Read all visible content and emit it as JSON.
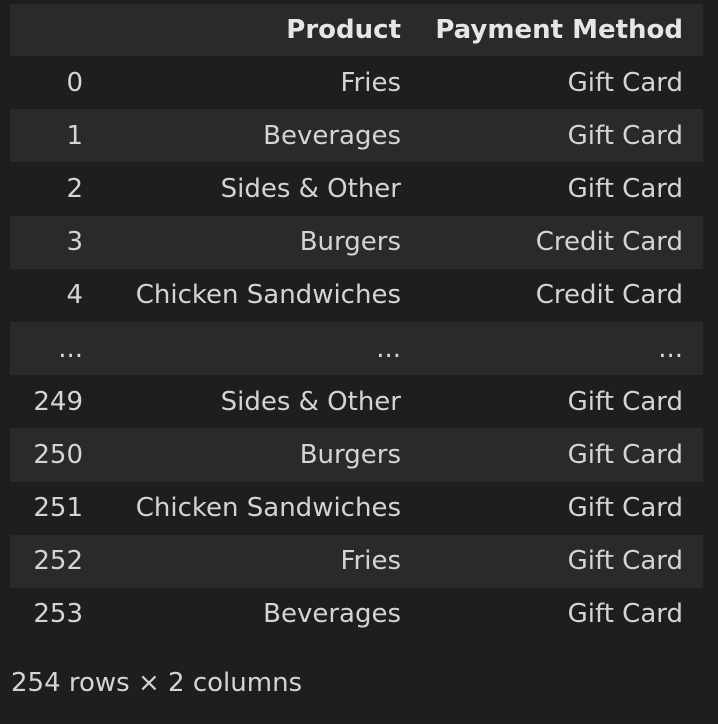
{
  "table": {
    "headers": {
      "index": "",
      "product": "Product",
      "payment": "Payment Method"
    },
    "rows": [
      {
        "index": "0",
        "product": "Fries",
        "payment": "Gift Card"
      },
      {
        "index": "1",
        "product": "Beverages",
        "payment": "Gift Card"
      },
      {
        "index": "2",
        "product": "Sides & Other",
        "payment": "Gift Card"
      },
      {
        "index": "3",
        "product": "Burgers",
        "payment": "Credit Card"
      },
      {
        "index": "4",
        "product": "Chicken Sandwiches",
        "payment": "Credit Card"
      },
      {
        "index": "...",
        "product": "...",
        "payment": "..."
      },
      {
        "index": "249",
        "product": "Sides & Other",
        "payment": "Gift Card"
      },
      {
        "index": "250",
        "product": "Burgers",
        "payment": "Gift Card"
      },
      {
        "index": "251",
        "product": "Chicken Sandwiches",
        "payment": "Gift Card"
      },
      {
        "index": "252",
        "product": "Fries",
        "payment": "Gift Card"
      },
      {
        "index": "253",
        "product": "Beverages",
        "payment": "Gift Card"
      }
    ]
  },
  "summary": "254 rows × 2 columns",
  "colors": {
    "background": "#1e1e1e",
    "stripe": "#2a2a2a",
    "text": "#d4d4d4"
  }
}
